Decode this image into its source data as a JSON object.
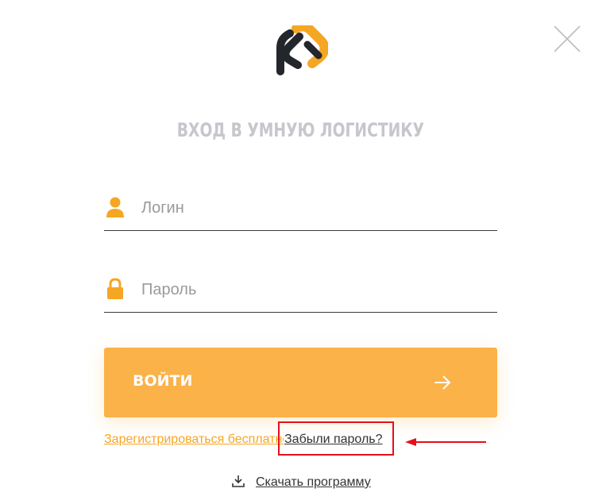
{
  "header": {
    "title": "ВХОД В УМНУЮ ЛОГИСТИКУ",
    "logo_icon": "brand-logo-icon",
    "close_icon": "close-icon"
  },
  "form": {
    "login": {
      "placeholder": "Логин",
      "value": "",
      "icon": "user-icon"
    },
    "password": {
      "placeholder": "Пароль",
      "value": "",
      "icon": "lock-icon"
    },
    "submit": {
      "label": "ВОЙТИ",
      "icon": "arrow-right-icon"
    }
  },
  "links": {
    "register": "Зарегистрироваться бесплатно",
    "forgot": "Забыли пароль?",
    "download": "Скачать программу",
    "download_icon": "download-icon"
  },
  "colors": {
    "accent": "#fbb248",
    "icon_orange": "#f5a623",
    "title_gray": "#c6c6cc",
    "annotation_red": "#e3101c"
  }
}
